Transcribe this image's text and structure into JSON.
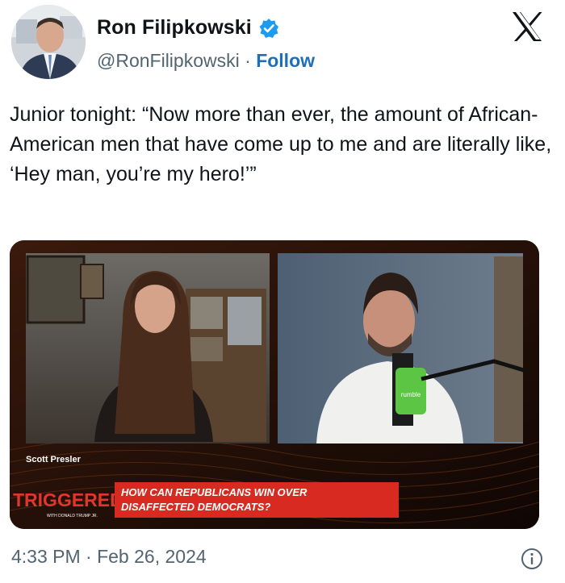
{
  "author": {
    "name": "Ron Filipkowski",
    "handle": "@RonFilipkowski",
    "separator": "·",
    "follow_label": "Follow"
  },
  "icons": {
    "verified": "verified-badge-icon",
    "x_logo": "x-logo-icon",
    "info": "info-icon"
  },
  "tweet": {
    "text": "Junior tonight: “Now more than ever, the amount of African-American men that have come up to me and are literally like, ‘Hey man, you’re my hero!’”"
  },
  "media": {
    "speaker_nameplate": "Scott Presler",
    "show_logo": "TRIGGERED",
    "show_byline": "WITH DONALD TRUMP JR.",
    "headline_line1": "HOW CAN REPUBLICANS WIN OVER",
    "headline_line2": "DISAFFECTED DEMOCRATS?",
    "mic_label": "rumble"
  },
  "footer": {
    "timestamp": "4:33 PM · Feb 26, 2024"
  },
  "colors": {
    "verified_blue": "#1d9bf0",
    "follow_link": "#1d6fb8",
    "secondary_text": "#536471",
    "banner_red": "#d82a20",
    "show_logo_red": "#e0362b",
    "rumble_green": "#5cc543"
  }
}
